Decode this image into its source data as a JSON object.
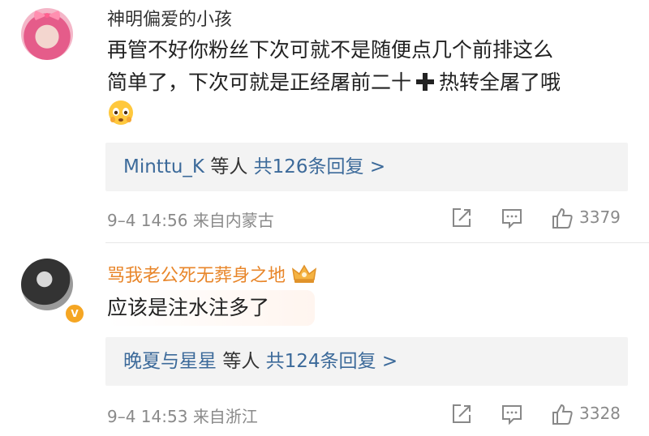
{
  "comments": [
    {
      "username": "神明偏爱的小孩",
      "text_line1": "再管不好你粉丝下次可就不是随便点几个前排这么",
      "text_line2_a": "简单了，下次可就是正经屠前二十",
      "text_line2_b": "热转全屠了哦",
      "emoji": "worried-face-emoji",
      "reply_names": "Minttu_K",
      "reply_suffix": "等人",
      "reply_count": "共126条回复 >",
      "time": "9–4 14:56",
      "source": "来自内蒙古",
      "likes": "3379"
    },
    {
      "username": "骂我老公死无葬身之地",
      "verified": true,
      "badge_icon": "crown-icon",
      "text": "应该是注水注多了",
      "reply_names": "晚夏与星星",
      "reply_suffix": "等人",
      "reply_count": "共124条回复 >",
      "time": "9–4 14:53",
      "source": "来自浙江",
      "likes": "3328"
    }
  ],
  "colors": {
    "link": "#3c6a9a",
    "vip_name": "#e8862a",
    "meta": "#8a8a8a",
    "reply_bg": "#f3f3f3",
    "verified_badge": "#f5a623"
  }
}
